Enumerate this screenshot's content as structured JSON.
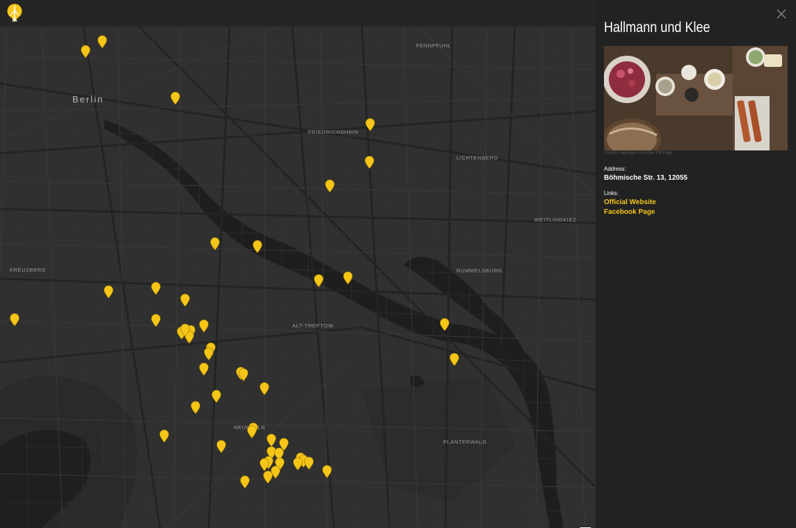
{
  "app": {
    "logo_icon": "pin-logo-icon",
    "accent": "#f5c518"
  },
  "map": {
    "city_label": "Berlin",
    "districts": [
      "FENNPFUHL",
      "FRIEDRICHSHAIN",
      "LICHTENBERG",
      "WEITLINGKIEZ",
      "KREUZBERG",
      "RUMMELSBURG",
      "ALT-TREPTOW",
      "NEUKÖLLN",
      "PLÄNTERWALD"
    ],
    "marker_color": "#f5c518",
    "marker_count": 49,
    "zoom_in_label": "+",
    "zoom_out_label": "−"
  },
  "panel": {
    "title": "Hallmann und Klee",
    "photo_credit": "Credits: Hallmann und Klee FB Page",
    "address_label": "Address:",
    "address": "Böhmische Str. 13, 12055",
    "links_label": "Links:",
    "links": [
      {
        "label": "Official Website"
      },
      {
        "label": "Facebook Page"
      }
    ],
    "close_icon": "close-icon"
  }
}
